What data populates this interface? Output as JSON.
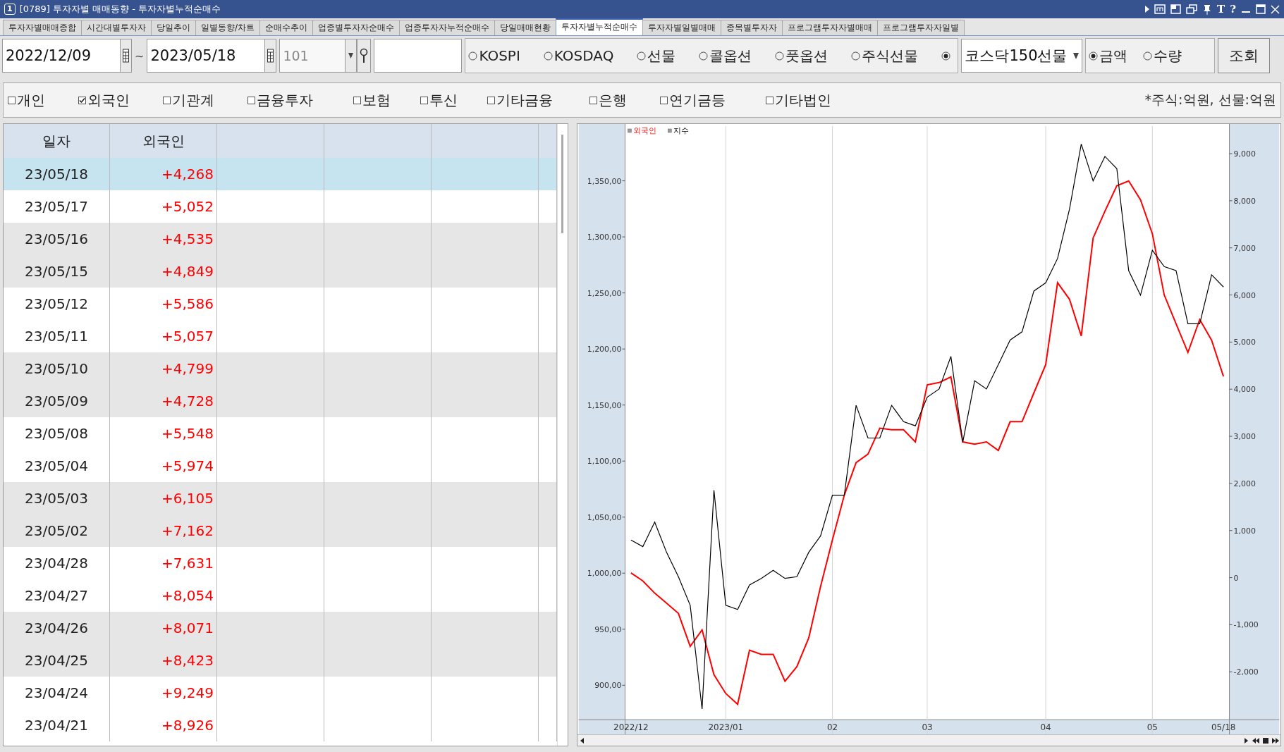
{
  "window": {
    "number": "1",
    "title": "[0789] 투자자별 매매동향 - 투자자별누적순매수",
    "text_buttons": [
      "T",
      "?"
    ]
  },
  "tabs": [
    {
      "label": "투자자별매매종합",
      "selected": false
    },
    {
      "label": "시간대별투자자",
      "selected": false
    },
    {
      "label": "당일추이",
      "selected": false
    },
    {
      "label": "일별동향/차트",
      "selected": false
    },
    {
      "label": "순매수추이",
      "selected": false
    },
    {
      "label": "업종별투자자순매수",
      "selected": false
    },
    {
      "label": "업종투자자누적순매수",
      "selected": false
    },
    {
      "label": "당일매매현황",
      "selected": false
    },
    {
      "label": "투자자별누적순매수",
      "selected": true
    },
    {
      "label": "투자자별일별매매",
      "selected": false
    },
    {
      "label": "종목별투자자",
      "selected": false
    },
    {
      "label": "프로그램투자자별매매",
      "selected": false
    },
    {
      "label": "프로그램투자자일별",
      "selected": false
    }
  ],
  "toolbar": {
    "start_date": "2022/12/09",
    "separator": "~",
    "end_date": "2023/05/18",
    "code": "101",
    "markets": [
      {
        "label": "KOSPI",
        "selected": false
      },
      {
        "label": "KOSDAQ",
        "selected": false
      },
      {
        "label": "선물",
        "selected": false
      },
      {
        "label": "콜옵션",
        "selected": false
      },
      {
        "label": "풋옵션",
        "selected": false
      },
      {
        "label": "주식선물",
        "selected": false
      },
      {
        "selected": true
      }
    ],
    "product": "코스닥150선물",
    "units": [
      {
        "label": "금액",
        "selected": true
      },
      {
        "label": "수량",
        "selected": false
      }
    ],
    "query_button": "조회"
  },
  "investors": [
    {
      "label": "개인",
      "checked": false
    },
    {
      "label": "외국인",
      "checked": true
    },
    {
      "label": "기관계",
      "checked": false
    },
    {
      "label": "금융투자",
      "checked": false
    },
    {
      "label": "보험",
      "checked": false
    },
    {
      "label": "투신",
      "checked": false
    },
    {
      "label": "기타금융",
      "checked": false
    },
    {
      "label": "은행",
      "checked": false
    },
    {
      "label": "연기금등",
      "checked": false
    },
    {
      "label": "기타법인",
      "checked": false
    }
  ],
  "unit_note": "*주식:억원, 선물:억원",
  "table": {
    "columns": [
      "일자",
      "외국인"
    ],
    "rows": [
      {
        "date": "23/05/18",
        "value": "+4,268",
        "selected": true
      },
      {
        "date": "23/05/17",
        "value": "+5,052",
        "selected": false
      },
      {
        "date": "23/05/16",
        "value": "+4,535",
        "selected": false
      },
      {
        "date": "23/05/15",
        "value": "+4,849",
        "selected": false
      },
      {
        "date": "23/05/12",
        "value": "+5,586",
        "selected": false
      },
      {
        "date": "23/05/11",
        "value": "+5,057",
        "selected": false
      },
      {
        "date": "23/05/10",
        "value": "+4,799",
        "selected": false
      },
      {
        "date": "23/05/09",
        "value": "+4,728",
        "selected": false
      },
      {
        "date": "23/05/08",
        "value": "+5,548",
        "selected": false
      },
      {
        "date": "23/05/04",
        "value": "+5,974",
        "selected": false
      },
      {
        "date": "23/05/03",
        "value": "+6,105",
        "selected": false
      },
      {
        "date": "23/05/02",
        "value": "+7,162",
        "selected": false
      },
      {
        "date": "23/04/28",
        "value": "+7,631",
        "selected": false
      },
      {
        "date": "23/04/27",
        "value": "+8,054",
        "selected": false
      },
      {
        "date": "23/04/26",
        "value": "+8,071",
        "selected": false
      },
      {
        "date": "23/04/25",
        "value": "+8,423",
        "selected": false
      },
      {
        "date": "23/04/24",
        "value": "+9,249",
        "selected": false
      },
      {
        "date": "23/04/21",
        "value": "+8,926",
        "selected": false
      }
    ]
  },
  "chart": {
    "chart_data": {
      "type": "line",
      "categories": [
        "2022/12",
        null,
        null,
        null,
        null,
        null,
        null,
        null,
        "2023/01",
        null,
        null,
        null,
        null,
        null,
        null,
        null,
        null,
        "02",
        null,
        null,
        null,
        null,
        null,
        null,
        null,
        "03",
        null,
        null,
        null,
        null,
        null,
        null,
        null,
        null,
        null,
        "04",
        null,
        null,
        null,
        null,
        null,
        null,
        null,
        null,
        "05",
        null,
        null,
        null,
        null,
        null,
        "05/18"
      ],
      "grid": "x",
      "ylim": [
        869.3,
        1398.8
      ],
      "yticks": [
        {
          "value": 900,
          "label": "900,00"
        },
        {
          "value": 950,
          "label": "950,00"
        },
        {
          "value": 1000,
          "label": "1,000,00"
        },
        {
          "value": 1050,
          "label": "1,050,00"
        },
        {
          "value": 1100,
          "label": "1,100,00"
        },
        {
          "value": 1150,
          "label": "1,150,00"
        },
        {
          "value": 1200,
          "label": "1,200,00"
        },
        {
          "value": 1250,
          "label": "1,250,00"
        },
        {
          "value": 1300,
          "label": "1,300,00"
        },
        {
          "value": 1350,
          "label": "1,350,00"
        }
      ],
      "y2lim": [
        -3016,
        9584
      ],
      "y2ticks": [
        {
          "value": -2000,
          "label": "-2,000"
        },
        {
          "value": -1000,
          "label": "-1,000"
        },
        {
          "value": 0,
          "label": "0"
        },
        {
          "value": 1000,
          "label": "1,000"
        },
        {
          "value": 2000,
          "label": "2,000"
        },
        {
          "value": 3000,
          "label": "3,000"
        },
        {
          "value": 4000,
          "label": "4,000"
        },
        {
          "value": 5000,
          "label": "5,000"
        },
        {
          "value": 6000,
          "label": "6,000"
        },
        {
          "value": 7000,
          "label": "7,000"
        },
        {
          "value": 8000,
          "label": "8,000"
        },
        {
          "value": 9000,
          "label": "9,000"
        }
      ],
      "series": [
        {
          "name": "외국인",
          "color": "#ff0000",
          "axis": "y2",
          "values": [
            100,
            -70,
            -330,
            -540,
            -760,
            -1460,
            -1110,
            -2060,
            -2460,
            -2690,
            -1540,
            -1630,
            -1630,
            -2200,
            -1890,
            -1280,
            -190,
            800,
            1750,
            2440,
            2620,
            3170,
            3140,
            3140,
            2880,
            4090,
            4140,
            4260,
            2880,
            2830,
            2880,
            2700,
            3310,
            3310,
            3920,
            4520,
            6260,
            5910,
            5130,
            7210,
            7780,
            8320,
            8420,
            8020,
            7300,
            6000,
            5390,
            4780,
            5480,
            5040,
            4270
          ]
        },
        {
          "name": "지수",
          "color": "#000000",
          "values": [
            1029.5,
            1023.7,
            1045.6,
            1018.6,
            996.8,
            971.3,
            878.8,
            1074,
            971.3,
            967.6,
            989.5,
            995.3,
            1002.6,
            995.3,
            996.8,
            1018.6,
            1033.2,
            1069.6,
            1069.6,
            1149.7,
            1120.6,
            1120.6,
            1149.7,
            1135.1,
            1131.5,
            1157,
            1164.3,
            1193.4,
            1116.9,
            1171.6,
            1164.3,
            1186.1,
            1208,
            1215.3,
            1251.7,
            1259,
            1280.8,
            1324.5,
            1382.8,
            1350,
            1371.8,
            1360.9,
            1269.9,
            1248,
            1288.1,
            1273.5,
            1269.9,
            1222.5,
            1222.5,
            1266.2,
            1255.3
          ]
        }
      ]
    }
  }
}
